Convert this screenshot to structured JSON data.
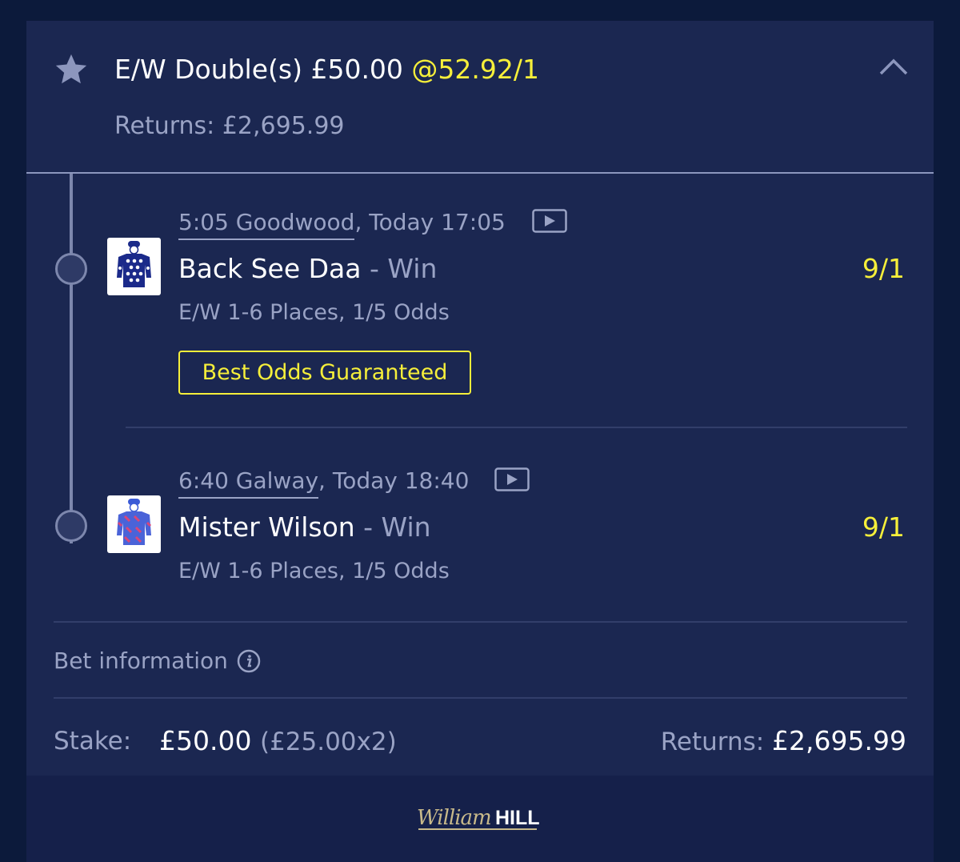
{
  "bet": {
    "title": "E/W Double(s) £50.00 ",
    "odds": "@52.92/1",
    "returns_label": "Returns: £2,695.99"
  },
  "selections": [
    {
      "venue_time": "5:05 Goodwood",
      "race_rest": ", Today 17:05",
      "horse": "Back See Daa",
      "market": " - Win",
      "price": "9/1",
      "ew_terms": "E/W 1-6 Places, 1/5 Odds",
      "badge": "Best Odds Guaranteed"
    },
    {
      "venue_time": "6:40 Galway",
      "race_rest": ", Today 18:40",
      "horse": "Mister Wilson",
      "market": " - Win",
      "price": "9/1",
      "ew_terms": "E/W 1-6 Places, 1/5 Odds"
    }
  ],
  "bet_information_label": "Bet information",
  "stake": {
    "label": "Stake:",
    "amount": "£50.00",
    "split": "(£25.00x2)",
    "returns_label": "Returns: ",
    "returns_amount": "£2,695.99"
  },
  "footer": {
    "logo_script": "William",
    "logo_bold": "HILL"
  },
  "colors": {
    "page_bg": "#0c1a3b",
    "card_bg": "#1b2751",
    "accent_yellow": "#f6ef3a",
    "muted_text": "#9aa3c5"
  },
  "icons": [
    "star-icon",
    "chevron-up-icon",
    "play-video-icon",
    "jockey-silk-icon",
    "info-icon"
  ]
}
